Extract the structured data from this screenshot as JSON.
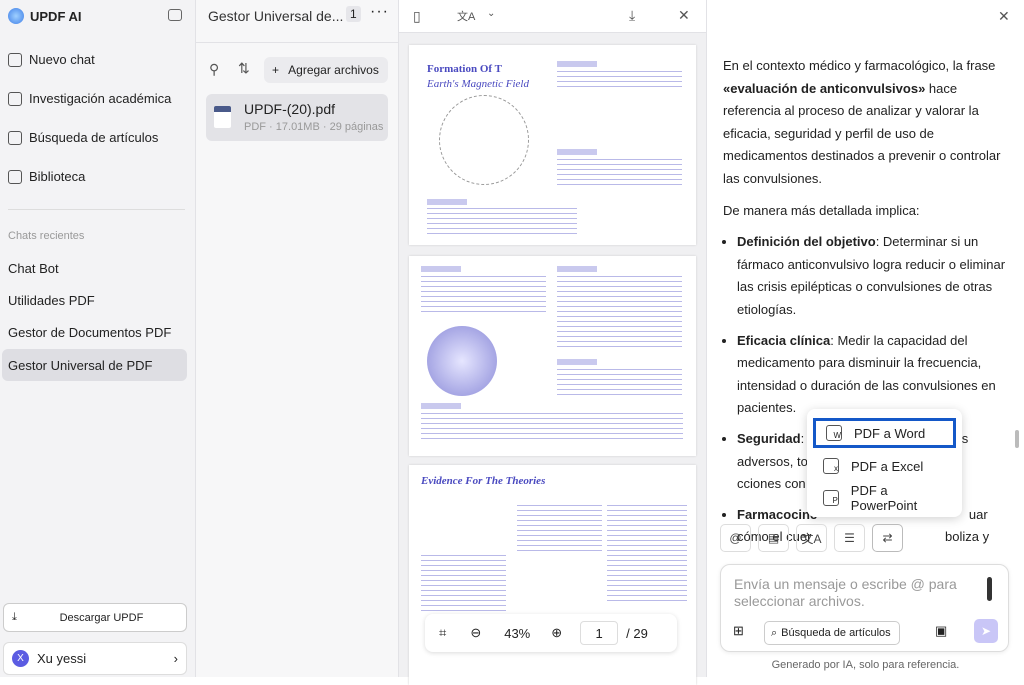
{
  "app": {
    "title": "UPDF AI"
  },
  "sidebar": {
    "nav": [
      {
        "label": "Nuevo chat",
        "icon": "edit-icon"
      },
      {
        "label": "Investigación académica",
        "icon": "megaphone-icon"
      },
      {
        "label": "Búsqueda de artículos",
        "icon": "search-doc-icon"
      },
      {
        "label": "Biblioteca",
        "icon": "library-icon"
      }
    ],
    "recent_header": "Chats recientes",
    "recent": [
      "Chat Bot",
      "Utilidades PDF",
      "Gestor de Documentos PDF",
      "Gestor Universal de PDF"
    ],
    "download": "Descargar UPDF",
    "user": {
      "initial": "X",
      "name": "Xu yessi"
    }
  },
  "files": {
    "title": "Gestor Universal de...",
    "count": "1",
    "add_label": "Agregar archivos",
    "items": [
      {
        "name": "UPDF-(20).pdf",
        "meta": "PDF · 17.01MB · 29 páginas"
      }
    ]
  },
  "viewer": {
    "zoom": "43%",
    "page": "1",
    "total": "/ 29",
    "pages": [
      {
        "title": "Formation Of T",
        "subtitle": "Earth's Magnetic Field"
      },
      {
        "title": ""
      },
      {
        "title": "Evidence For The Theories"
      }
    ]
  },
  "chat": {
    "intro_pre": "En el contexto médico y farmacológico, la frase ",
    "intro_bold": "«evaluación de anticonvulsivos»",
    "intro_post": " hace referencia al proceso de analizar y valorar la eficacia, seguridad y perfil de uso de medicamentos destinados a prevenir o controlar las convulsiones.",
    "detail": "De manera más detallada implica:",
    "bullets": [
      {
        "bold": "Definición del objetivo",
        "text": ": Determinar si un fármaco anticonvulsivo logra reducir o eliminar las crisis epilépticas o convulsiones de otras etiologías."
      },
      {
        "bold": "Eficacia clínica",
        "text": ": Medir la capacidad del medicamento para disminuir la frecuencia, intensidad o duración de las convulsiones en pacientes."
      },
      {
        "bold": "Seguridad",
        "text": ": Observar y registrar efectos adversos, tolerancia a l                                    cciones con otros fár"
      },
      {
        "bold": "Farmacociné",
        "text": "                                          uar cómo el cuer                                     boliza y"
      }
    ],
    "menu": [
      "PDF a Word",
      "PDF a Excel",
      "PDF a PowerPoint"
    ],
    "placeholder": "Envía un mensaje o escribe @ para seleccionar archivos.",
    "search_articles": "Búsqueda de artículos",
    "footer": "Generado por IA, solo para referencia."
  }
}
